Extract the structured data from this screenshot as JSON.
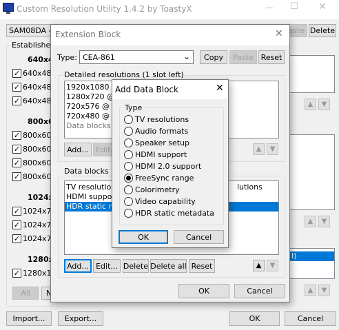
{
  "main": {
    "title": "Custom Resolution Utility 1.4.2 by ToastyX",
    "monitor_value": "SAM08DA - S",
    "paste_label": "aste",
    "delete_label": "Delete",
    "established_label": "Established",
    "groups": [
      {
        "heading": "640x48",
        "items": [
          "640x48",
          "640x48",
          "640x48"
        ]
      },
      {
        "heading": "800x60",
        "items": [
          "800x60",
          "800x60",
          "800x60",
          "800x60"
        ]
      },
      {
        "heading": "1024x7",
        "items": [
          "1024x76",
          "1024x76",
          "1024x76"
        ]
      },
      {
        "heading": "1280x1",
        "items": [
          "1280x10"
        ]
      }
    ],
    "all_label": "All",
    "none_label": "N",
    "right_list_partial": "lutions",
    "right_list_partial2": "I)",
    "import_label": "Import...",
    "export_label": "Export...",
    "ok_label": "OK",
    "cancel_label": "Cancel"
  },
  "ext": {
    "title": "Extension Block",
    "type_label": "Type:",
    "type_value": "CEA-861",
    "copy_label": "Copy",
    "paste_label": "Paste",
    "reset_label": "Reset",
    "detailed_label": "Detailed resolutions (1 slot left)",
    "detailed_items": [
      "1920x1080 @",
      "1280x720 @ 5",
      "720x576 @ 50",
      "720x480 @ 59",
      "Data blocks (2"
    ],
    "add_label": "Add...",
    "edit_label": "Edit...",
    "datablocks_label": "Data blocks (3",
    "datablock_items": [
      "TV resolutions",
      "HDMI support",
      "HDR static me"
    ],
    "db_add_label": "Add...",
    "db_edit_label": "Edit...",
    "db_delete_label": "Delete",
    "db_deleteall_label": "Delete all",
    "db_reset_label": "Reset",
    "ok_label": "OK",
    "cancel_label": "Cancel"
  },
  "adb": {
    "title": "Add Data Block",
    "type_label": "Type",
    "options": [
      "TV resolutions",
      "Audio formats",
      "Speaker setup",
      "HDMI support",
      "HDMI 2.0 support",
      "FreeSync range",
      "Colorimetry",
      "Video capability",
      "HDR static metadata"
    ],
    "selected_index": 5,
    "ok_label": "OK",
    "cancel_label": "Cancel"
  }
}
